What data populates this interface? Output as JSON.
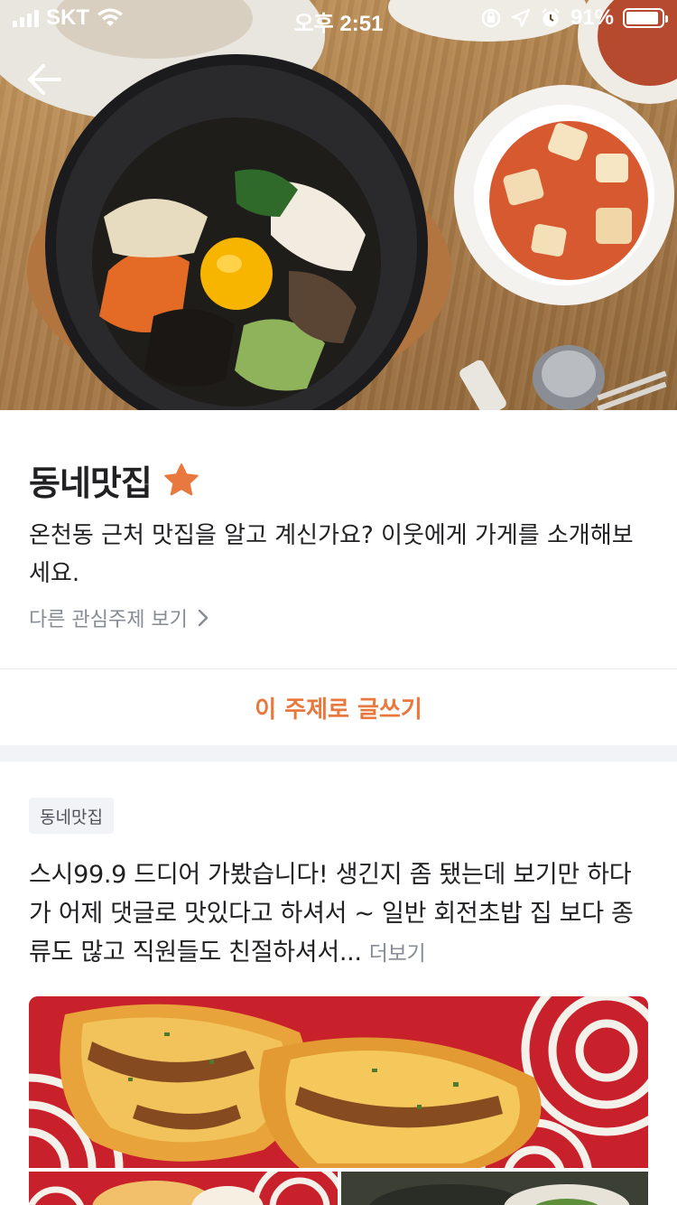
{
  "status_bar": {
    "carrier": "SKT",
    "time": "오후 2:51",
    "battery_text": "91%",
    "battery_level": 0.91,
    "icons": [
      "signal-icon",
      "wifi-icon",
      "rotation-lock-icon",
      "location-icon",
      "alarm-icon",
      "battery-icon"
    ]
  },
  "header": {
    "back_icon": "back-arrow-icon",
    "hero_image": "bibimbap-photo"
  },
  "topic": {
    "title": "동네맛집",
    "title_icon": "star-icon",
    "description": "온천동 근처 맛집을 알고 계신가요? 이웃에게 가게를 소개해보세요.",
    "other_topics_link": "다른 관심주제 보기"
  },
  "write_button": {
    "label": "이 주제로 글쓰기"
  },
  "post": {
    "tag": "동네맛집",
    "body": "스시99.9 드디어 가봤습니다! 생긴지 좀 됐는데 보기만 하다가 어제 댓글로 맛있다고 하셔서 ~ 일반 회전초밥 집 보다 종류도 많고 직원들도 친절하셔서...",
    "more_label": "더보기",
    "images": [
      "sushi-photo-main",
      "sushi-photo-2",
      "sushi-photo-3"
    ]
  },
  "colors": {
    "accent": "#e8783e",
    "text_primary": "#212124",
    "text_secondary": "#868b94",
    "tag_bg": "#f2f3f6"
  }
}
